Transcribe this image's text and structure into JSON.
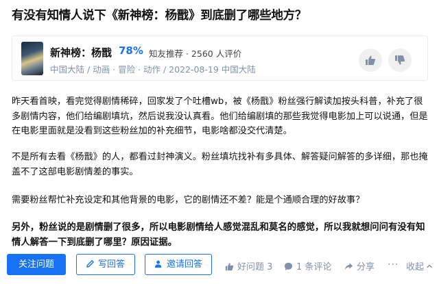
{
  "question": {
    "title": "有没有知情人说下《新神榜：杨戬》到底删了哪些地方？"
  },
  "movie_card": {
    "name": "新神榜：杨戬",
    "score": "78%",
    "score_meta": "知友推荐 · 2560 人评价",
    "meta": "中国大陆 / 动画 · 冒险 · 动作 / 2022-08-19 中国大陆"
  },
  "content": {
    "paragraphs": [
      "昨天看首映，看完觉得剧情稀碎，回家发了个吐槽wb，被《杨戬》粉丝强行解读加按头科普，补充了很多剧情内容，他们给编剧填坑，然后说我没认真看。他们给编剧填的那些我觉得电影加上可以说通，但是在电影里面就是没看到这些粉丝加的补充细节，电影啥都没交代清楚。",
      "不是所有去看《杨戬》的人，都看过封神演义。粉丝填坑找补有多具体、解答疑问解答的多详细，那也掩盖不了这部电影剧情差的事实。",
      "需要粉丝帮忙补充设定和其他背景的电影，它的剧情还不差？能是个通顺合理的好故事？",
      "另外，粉丝说的是剧情删了很多，所以电影剧情给人感觉混乱和莫名的感觉，所以我就想问问有没有知情人解答一下到底删了哪里？原因证据。"
    ]
  },
  "actions": {
    "follow_label": "关注问题",
    "write_label": "写回答",
    "invite_label": "邀请回答",
    "like_label": "好问题 3",
    "comment_label": "1 条评论",
    "share_label": "分享",
    "more_label": "···",
    "collapse_label": "收起"
  },
  "colors": {
    "accent": "#1772f6",
    "meta_gray": "#8590a6",
    "text": "#121212"
  }
}
